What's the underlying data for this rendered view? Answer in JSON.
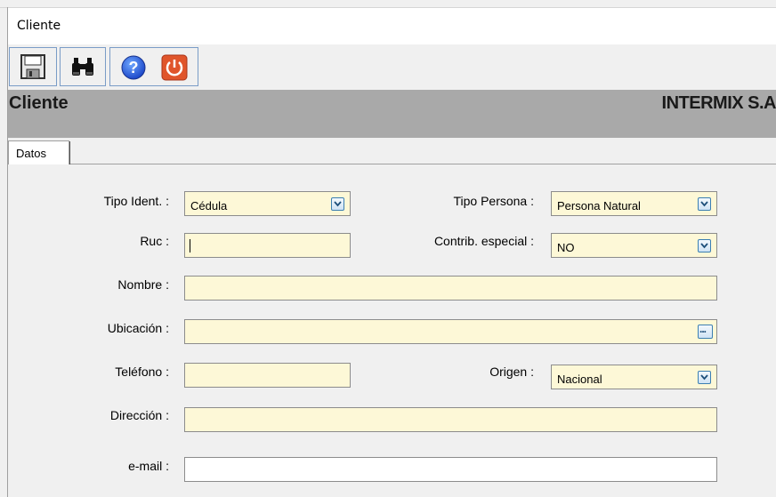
{
  "window": {
    "title": "Cliente"
  },
  "toolbar": {
    "buttons": [
      {
        "icon": "floppy-save-icon"
      },
      {
        "icon": "binoculars-search-icon"
      },
      {
        "icon": "help-icon"
      },
      {
        "icon": "power-exit-icon"
      }
    ]
  },
  "header": {
    "left": "Cliente",
    "right": "INTERMIX S.A"
  },
  "tabs": [
    {
      "label": "Datos",
      "active": true
    }
  ],
  "form": {
    "tipo_ident": {
      "label": "Tipo Ident. :",
      "value": "Cédula"
    },
    "tipo_persona": {
      "label": "Tipo Persona :",
      "value": "Persona Natural"
    },
    "ruc": {
      "label": "Ruc :",
      "value": ""
    },
    "contrib_especial": {
      "label": "Contrib. especial :",
      "value": "NO"
    },
    "nombre": {
      "label": "Nombre :",
      "value": ""
    },
    "ubicacion": {
      "label": "Ubicación :",
      "value": "",
      "button": "..."
    },
    "telefono": {
      "label": "Teléfono :",
      "value": ""
    },
    "origen": {
      "label": "Origen :",
      "value": "Nacional"
    },
    "direccion": {
      "label": "Dirección :",
      "value": ""
    },
    "email": {
      "label": "e-mail :",
      "value": ""
    }
  },
  "colors": {
    "field_bg": "#fdf8d7",
    "header_band": "#a9a9a9",
    "toolbar_border": "#7a9cc7"
  }
}
